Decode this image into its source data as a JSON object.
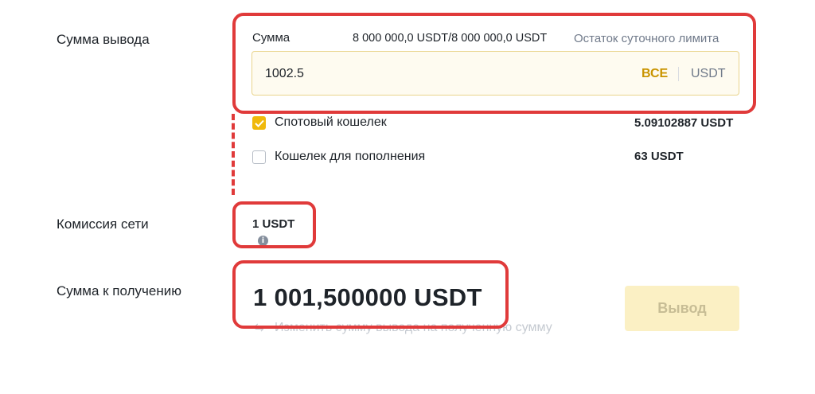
{
  "form": {
    "withdraw_amount_label": "Сумма вывода",
    "amount_field_label": "Сумма",
    "daily_limit_value": "8 000 000,0 USDT/8 000 000,0 USDT",
    "daily_limit_caption": "Остаток суточного лимита",
    "amount_value": "1002.5",
    "max_label": "ВСЕ",
    "unit": "USDT",
    "wallets": [
      {
        "label": "Спотовый кошелек",
        "balance": "5.09102887 USDT",
        "checked": true
      },
      {
        "label": "Кошелек для пополнения",
        "balance": "63 USDT",
        "checked": false
      }
    ],
    "network_fee_label": "Комиссия сети",
    "network_fee_value": "1 USDT",
    "info_icon_glyph": "i",
    "receive_label": "Сумма к получению",
    "receive_value": "1 001,500000 USDT",
    "switch_link": "Изменить сумму вывода на полученную сумму",
    "withdraw_button": "Вывод"
  },
  "colors": {
    "accent": "#f0b90b",
    "annotation_red": "#e03a3a",
    "disabled_button_bg": "#fbf0c4"
  }
}
